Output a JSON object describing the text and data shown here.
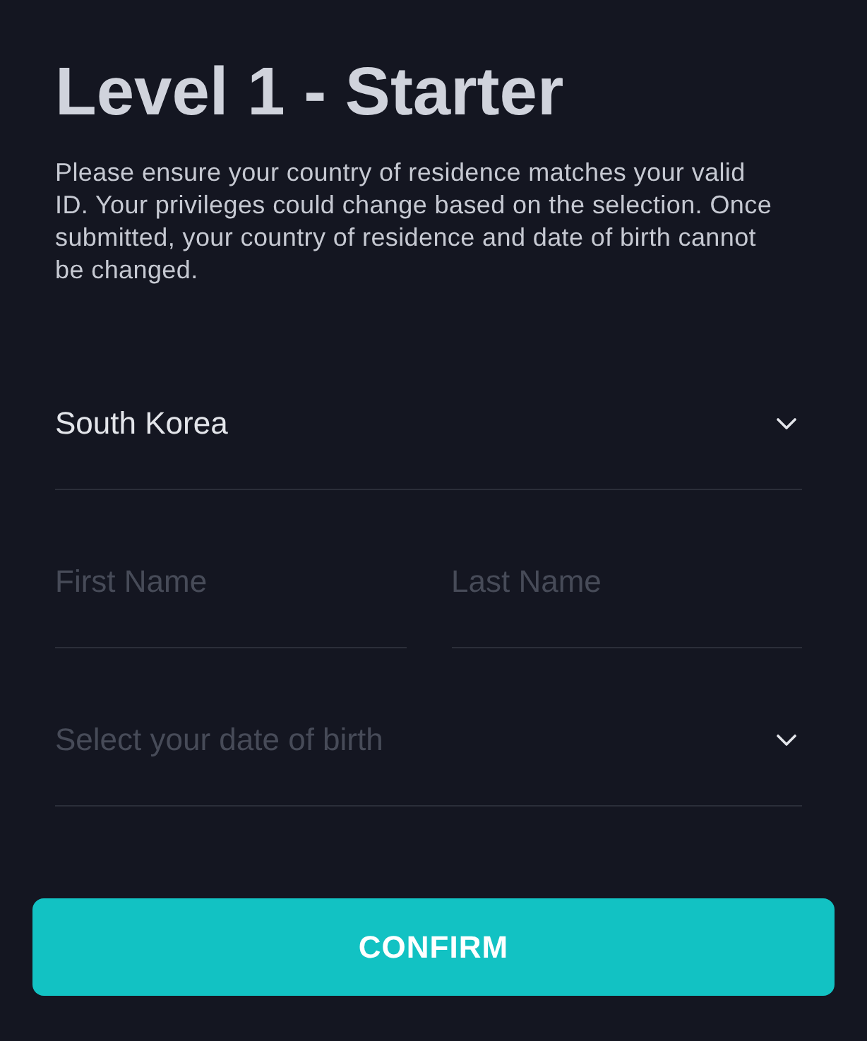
{
  "title": "Level 1 - Starter",
  "description": "Please ensure your country of residence matches your valid ID. Your privileges could change based on the selection. Once submitted, your country of residence and date of birth cannot be changed.",
  "country_select": {
    "value": "South Korea"
  },
  "name_fields": [
    {
      "placeholder": "First Name"
    },
    {
      "placeholder": "Last Name"
    }
  ],
  "birth_date_select": {
    "placeholder": "Select your date of birth"
  },
  "confirm_button": {
    "label": "CONFIRM"
  }
}
